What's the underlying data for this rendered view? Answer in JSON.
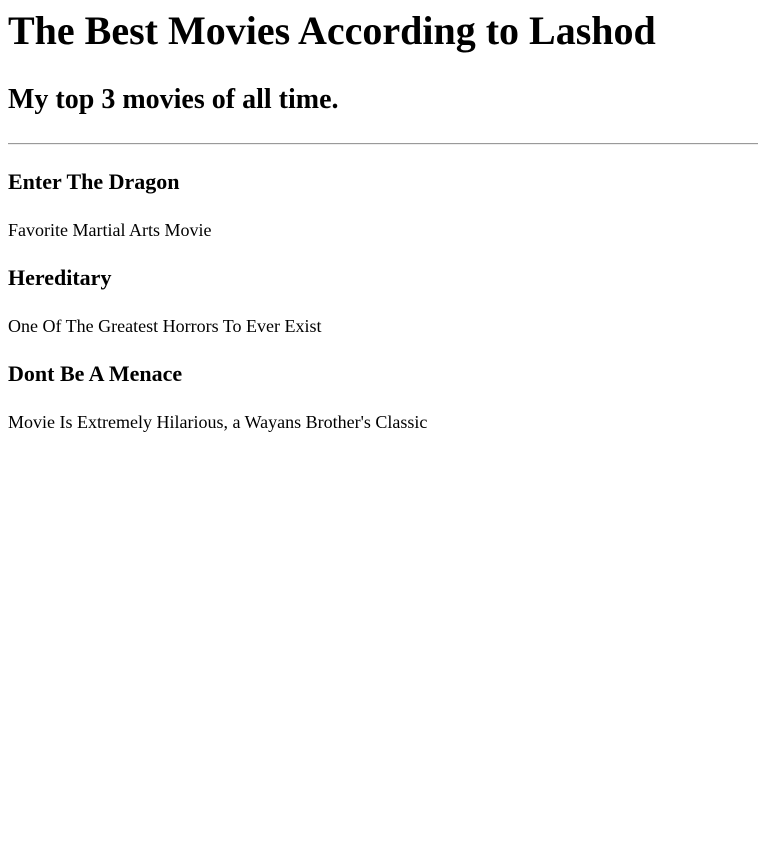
{
  "page": {
    "title": "The Best Movies According to Lashod",
    "subtitle": "My top 3 movies of all time."
  },
  "movies": [
    {
      "title": "Enter The Dragon",
      "description": "Favorite Martial Arts Movie"
    },
    {
      "title": "Hereditary",
      "description": "One Of The Greatest Horrors To Ever Exist"
    },
    {
      "title": "Dont Be A Menace",
      "description": "Movie Is Extremely Hilarious, a Wayans Brother's Classic"
    }
  ]
}
